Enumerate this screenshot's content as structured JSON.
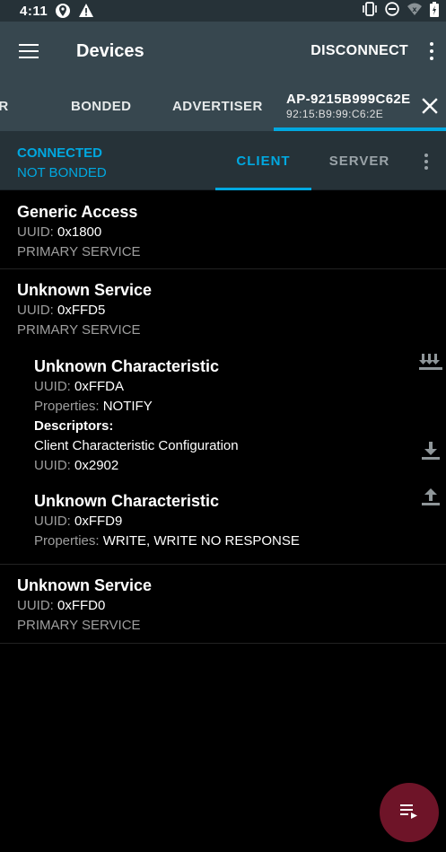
{
  "status_bar": {
    "time": "4:11",
    "left_icons": [
      "location-pin-icon",
      "warning-icon"
    ],
    "right_icons": [
      "vibrate-icon",
      "do-not-disturb-icon",
      "wifi-icon",
      "battery-icon"
    ]
  },
  "app_bar": {
    "title": "Devices",
    "action_label": "DISCONNECT",
    "menu_icon": "hamburger-icon",
    "overflow_icon": "more-vert-icon"
  },
  "tabs": {
    "scanner_label": "ER",
    "bonded_label": "BONDED",
    "advertiser_label": "ADVERTISER",
    "device_name": "AP-9215B999C62E",
    "device_address": "92:15:B9:99:C6:2E",
    "close_icon": "close-icon"
  },
  "connection": {
    "state": "CONNECTED",
    "bond_state": "NOT BONDED",
    "client_tab": "CLIENT",
    "server_tab": "SERVER"
  },
  "services": [
    {
      "name": "Generic Access",
      "uuid_label": "UUID:",
      "uuid": "0x1800",
      "type": "PRIMARY SERVICE"
    },
    {
      "name": "Unknown Service",
      "uuid_label": "UUID:",
      "uuid": "0xFFD5",
      "type": "PRIMARY SERVICE",
      "characteristics": [
        {
          "name": "Unknown Characteristic",
          "uuid_label": "UUID:",
          "uuid": "0xFFDA",
          "properties_label": "Properties:",
          "properties": "NOTIFY",
          "descriptors_label": "Descriptors:",
          "descriptor_name": "Client Characteristic Configuration",
          "descriptor_uuid_label": "UUID:",
          "descriptor_uuid": "0x2902",
          "action_icon": "notify-icon",
          "descriptor_action_icon": "download-icon"
        },
        {
          "name": "Unknown Characteristic",
          "uuid_label": "UUID:",
          "uuid": "0xFFD9",
          "properties_label": "Properties:",
          "properties": "WRITE, WRITE NO RESPONSE",
          "action_icon": "upload-icon"
        }
      ]
    },
    {
      "name": "Unknown Service",
      "uuid_label": "UUID:",
      "uuid": "0xFFD0",
      "type": "PRIMARY SERVICE"
    }
  ],
  "fab_icon": "log-list-icon",
  "colors": {
    "accent": "#00a8e0",
    "app_bar": "#37474f",
    "status_bar": "#263238",
    "fab": "#6e1428"
  }
}
